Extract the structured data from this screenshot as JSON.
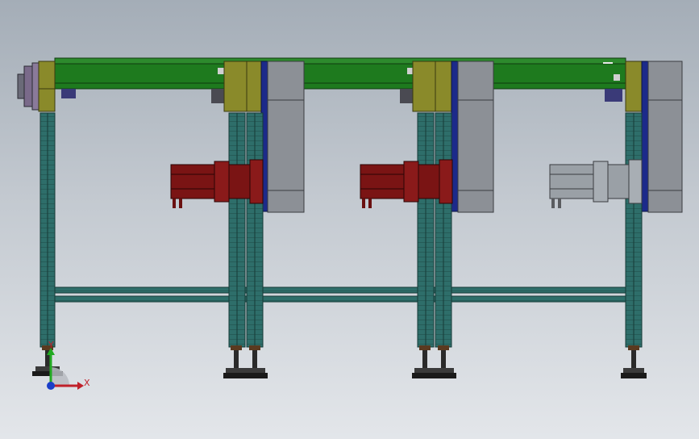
{
  "viewport": {
    "background_top": "#a4adb7",
    "background_bottom": "#e3e6ea"
  },
  "colors": {
    "beam_green": "#1e7a1e",
    "rail_teal": "#2e6e6a",
    "bracket_olive": "#8a8a2a",
    "plate_navy": "#1c2a8a",
    "housing_gray": "#8c9096",
    "motor_red": "#7a1414",
    "motor_gray": "#9aa0a6",
    "end_cap_purple": "#7a6a8a"
  },
  "model": {
    "motors": [
      {
        "name": "servo-motor-1",
        "state": "highlighted",
        "color": "#7a1414"
      },
      {
        "name": "servo-motor-2",
        "state": "highlighted",
        "color": "#7a1414"
      },
      {
        "name": "servo-motor-3",
        "state": "normal",
        "color": "#9aa0a6"
      }
    ]
  },
  "triad": {
    "x_label": "X",
    "y_label": "Y",
    "x_color": "#c0202a",
    "y_color": "#22aa22",
    "z_color": "#1a3ec8"
  }
}
